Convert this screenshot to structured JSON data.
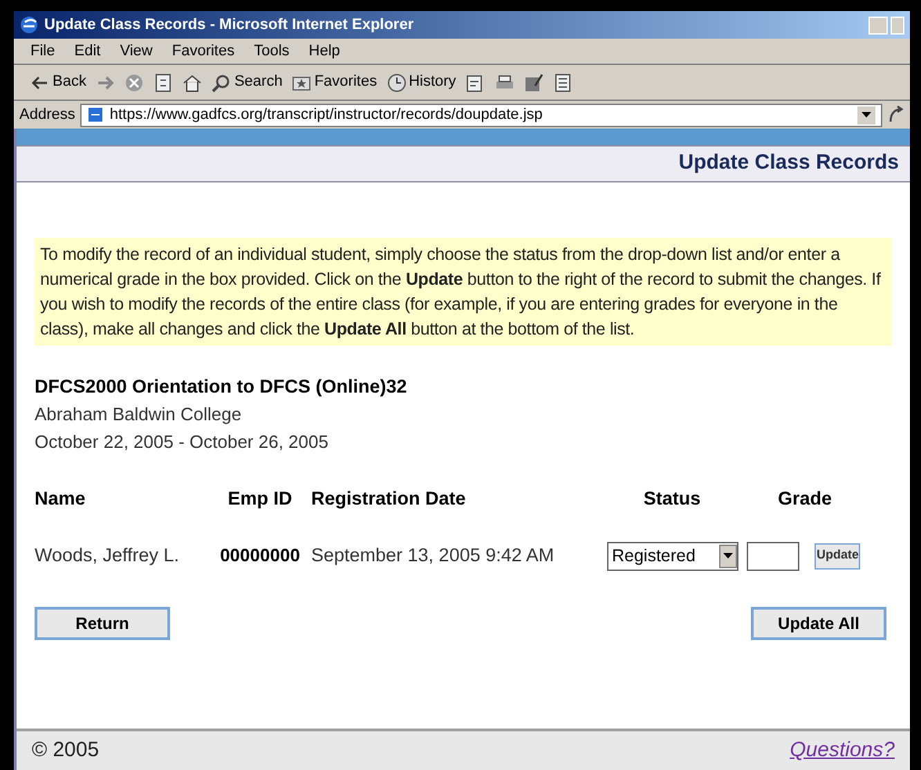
{
  "window": {
    "title": "Update Class Records - Microsoft Internet Explorer"
  },
  "menu": [
    "File",
    "Edit",
    "View",
    "Favorites",
    "Tools",
    "Help"
  ],
  "toolbar": [
    {
      "kind": "back",
      "label": "Back"
    },
    {
      "kind": "forward"
    },
    {
      "kind": "stop"
    },
    {
      "kind": "refresh"
    },
    {
      "kind": "home"
    },
    {
      "kind": "search",
      "label": "Search"
    },
    {
      "kind": "favorites",
      "label": "Favorites"
    },
    {
      "kind": "history",
      "label": "History"
    },
    {
      "kind": "mail"
    },
    {
      "kind": "print"
    },
    {
      "kind": "edit"
    },
    {
      "kind": "discuss"
    }
  ],
  "address": {
    "label": "Address",
    "url": "https://www.gadfcs.org/transcript/instructor/records/doupdate.jsp"
  },
  "page": {
    "heading": "Update Class Records",
    "instructions": "To modify the record of an individual student, simply choose the status from the drop-down list and/or enter a numerical grade in the box provided. Click on the **Update** button to the right of the record to submit the changes. If you wish to modify the records of the entire class (for example, if you are entering grades for everyone in the class), make all changes and click the **Update All** button at the bottom of the list.",
    "course": {
      "title": "DFCS2000 Orientation to DFCS (Online)32",
      "college": "Abraham Baldwin College",
      "dates": "October 22, 2005 - October 26, 2005"
    },
    "table": {
      "columns": [
        "Name",
        "Emp ID",
        "Registration Date",
        "Status",
        "Grade"
      ],
      "rows": [
        {
          "name": "Woods, Jeffrey L.",
          "emp_id": "00000000",
          "registration_date": "September 13, 2005 9:42 AM",
          "status": "Registered",
          "update": "Update"
        }
      ]
    },
    "buttons": [
      "Return",
      "Update All"
    ],
    "footer": {
      "copyright": "© 2005",
      "link": "Questions?"
    }
  }
}
